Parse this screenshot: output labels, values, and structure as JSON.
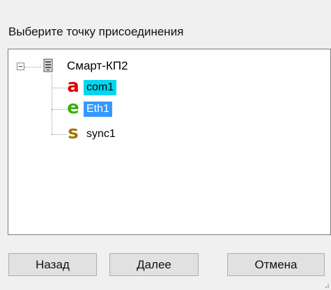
{
  "prompt": "Выберите точку присоединения",
  "tree": {
    "root": {
      "label": "Смарт-КП2",
      "icon": "server-icon",
      "expanded": true
    },
    "children": [
      {
        "glyph": "a",
        "glyph_color": "#e00000",
        "label": "com1",
        "selected_style": "cyan"
      },
      {
        "glyph": "e",
        "glyph_color": "#3cb000",
        "label": "Eth1",
        "selected_style": "blue"
      },
      {
        "glyph": "s",
        "glyph_color": "#a07800",
        "label": "sync1",
        "selected_style": "none"
      }
    ]
  },
  "buttons": {
    "back": "Назад",
    "next": "Далее",
    "cancel": "Отмена"
  },
  "colors": {
    "highlight_cyan": "#00d7f0",
    "highlight_blue": "#3399ff"
  }
}
